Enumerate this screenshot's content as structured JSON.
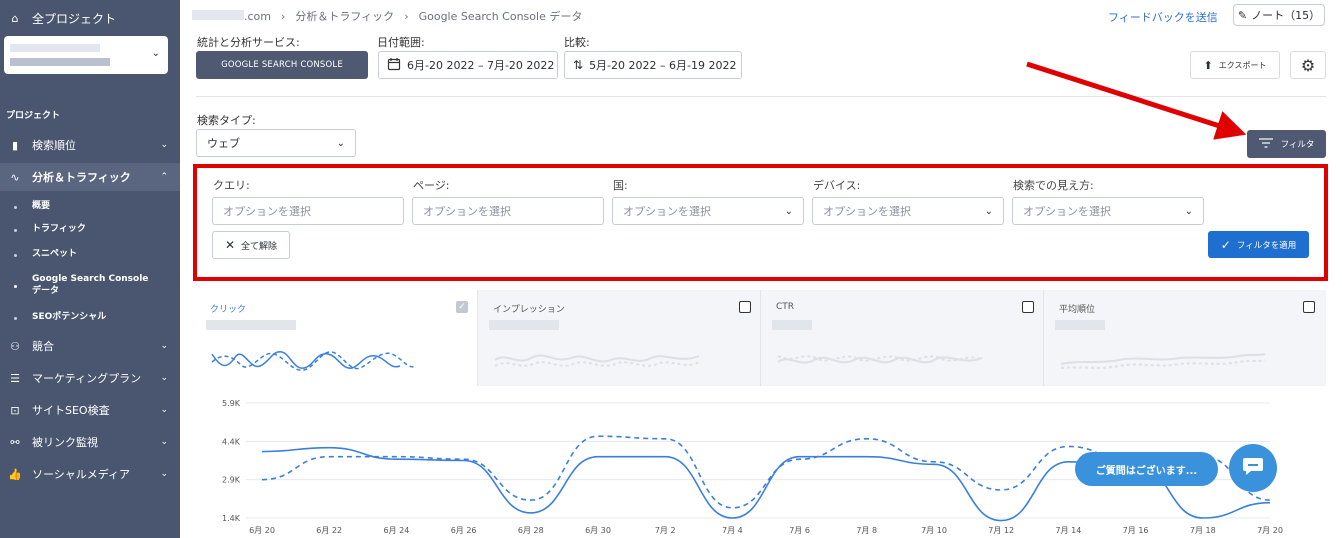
{
  "sidebar": {
    "all_projects": "全プロジェクト",
    "section_label": "プロジェクト",
    "items": [
      {
        "label": "検索順位",
        "icon": "bar-chart-icon"
      },
      {
        "label": "分析＆トラフィック",
        "icon": "pulse-icon"
      },
      {
        "label": "競合",
        "icon": "people-icon"
      },
      {
        "label": "マーケティングプラン",
        "icon": "checklist-icon"
      },
      {
        "label": "サイトSEO検査",
        "icon": "site-audit-icon"
      },
      {
        "label": "被リンク監視",
        "icon": "link-icon"
      },
      {
        "label": "ソーシャルメディア",
        "icon": "thumbs-up-icon"
      }
    ],
    "subitems": [
      "概要",
      "トラフィック",
      "スニペット",
      "Google Search Console データ",
      "SEOポテンシャル"
    ]
  },
  "breadcrumb": {
    "domain_suffix": ".com",
    "section": "分析＆トラフィック",
    "page": "Google Search Console データ"
  },
  "header": {
    "feedback": "フィードバックを送信",
    "notes": "ノート（15）",
    "service_label": "統計と分析サービス:",
    "service_button": "GOOGLE SEARCH CONSOLE",
    "date_label": "日付範囲:",
    "date_value": "6月-20 2022 – 7月-20 2022",
    "compare_label": "比較:",
    "compare_value": "5月-20 2022 – 6月-19 2022",
    "export": "エクスポート"
  },
  "search_type": {
    "label": "検索タイプ:",
    "value": "ウェブ"
  },
  "filter_button": "フィルタ",
  "filters": {
    "query_label": "クエリ:",
    "page_label": "ページ:",
    "country_label": "国:",
    "device_label": "デバイス:",
    "appearance_label": "検索での見え方:",
    "placeholder": "オプションを選択",
    "clear_all": "全て解除",
    "apply": "フィルタを適用"
  },
  "metrics": [
    {
      "title": "クリック",
      "checked": true
    },
    {
      "title": "インプレッション",
      "checked": false
    },
    {
      "title": "CTR",
      "checked": false
    },
    {
      "title": "平均順位",
      "checked": false
    }
  ],
  "chat": {
    "bubble": "ご質問はございます..."
  },
  "colors": {
    "sidebar_bg": "#4a5670",
    "primary_button": "#4f5972",
    "accent_blue": "#1f6fd0",
    "highlight_red": "#e00000",
    "series_blue": "#3a7fdc"
  },
  "chart_data": {
    "type": "line",
    "y_ticks": [
      "5.9K",
      "4.4K",
      "2.9K",
      "1.4K"
    ],
    "x_ticks": [
      "6月 20",
      "6月 22",
      "6月 24",
      "6月 26",
      "6月 28",
      "6月 30",
      "7月 2",
      "7月 4",
      "7月 6",
      "7月 8",
      "7月 10",
      "7月 12",
      "7月 14",
      "7月 16",
      "7月 18",
      "7月 20"
    ],
    "ylim": [
      1400,
      5900
    ],
    "series": [
      {
        "style": "solid",
        "values": [
          4000,
          4150,
          3700,
          3650,
          1600,
          3800,
          3800,
          1400,
          3800,
          3800,
          3500,
          1300,
          3600,
          3500,
          1400,
          2000
        ]
      },
      {
        "style": "dashed",
        "values": [
          2900,
          3800,
          3800,
          3700,
          2100,
          4600,
          4500,
          1800,
          3700,
          4500,
          3600,
          2500,
          4200,
          3500,
          3800,
          2100
        ]
      }
    ]
  }
}
